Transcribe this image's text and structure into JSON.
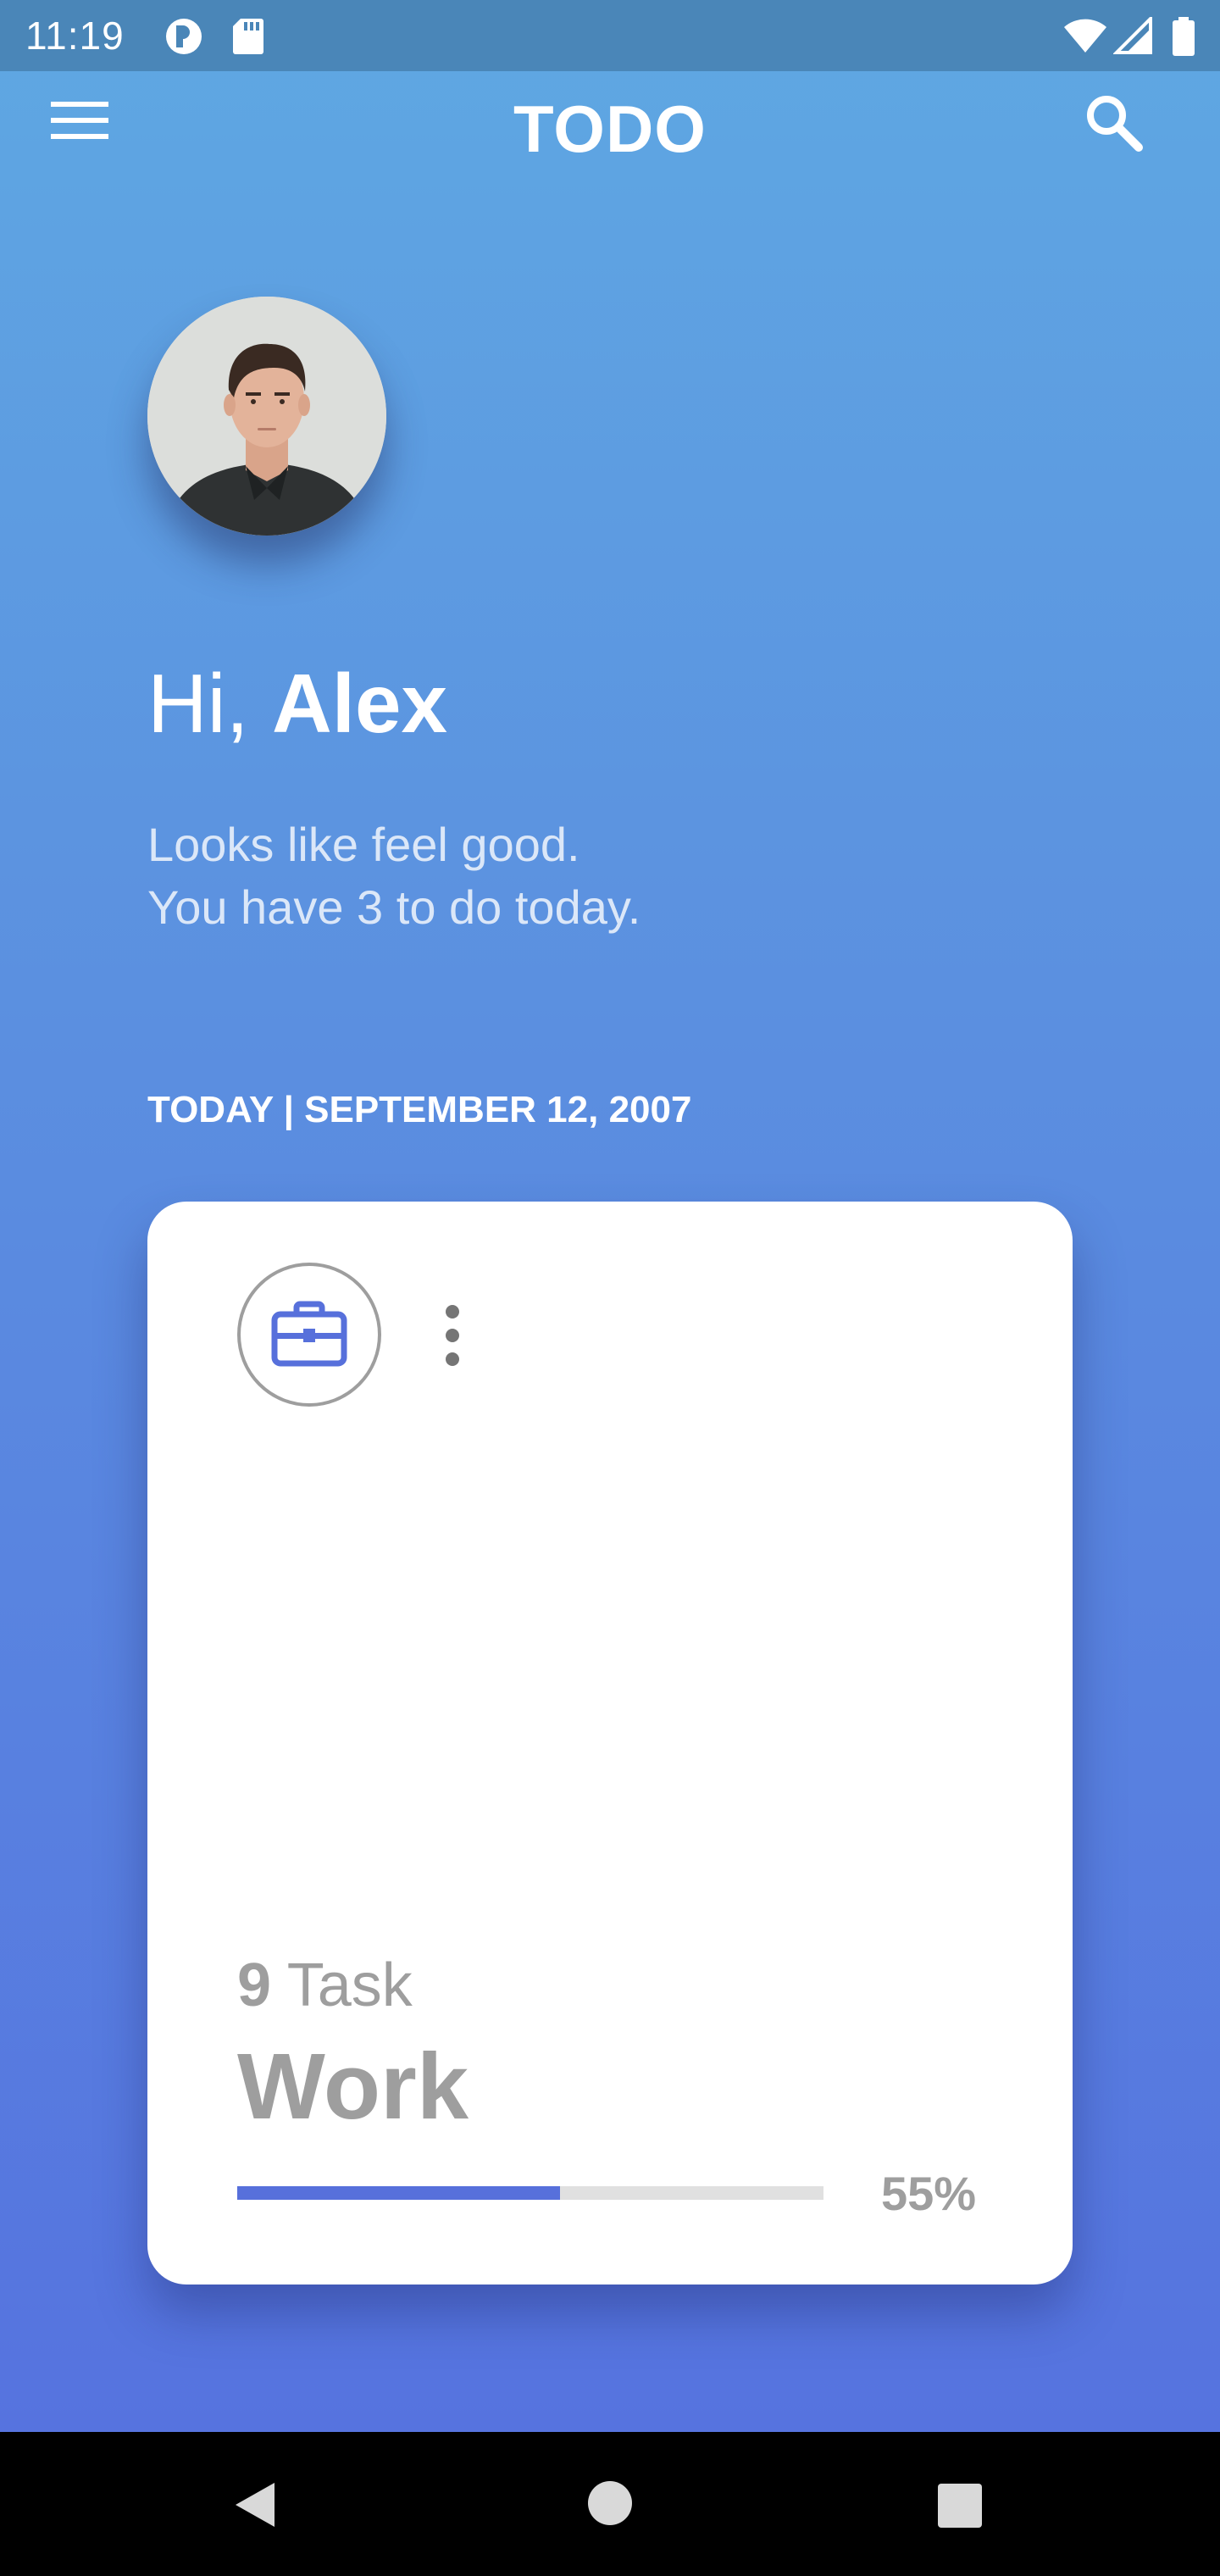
{
  "status_bar": {
    "time": "11:19"
  },
  "toolbar": {
    "title": "TODO",
    "menu_icon": "hamburger-menu-icon",
    "search_icon": "search-icon"
  },
  "profile": {
    "greeting_prefix": "Hi, ",
    "name": "Alex",
    "subtitle_line1": "Looks like feel good.",
    "subtitle_line2": "You have 3 to do today."
  },
  "date_heading": "TODAY | SEPTEMBER 12, 2007",
  "card": {
    "icon": "briefcase-icon",
    "task_count": "9",
    "task_label": " Task",
    "category": "Work",
    "progress_percent": 55,
    "progress_label": "55%"
  },
  "colors": {
    "accent": "#5770db",
    "background_top": "#5fa8e2",
    "background_bottom": "#5570df",
    "muted_text": "#9e9e9e"
  }
}
